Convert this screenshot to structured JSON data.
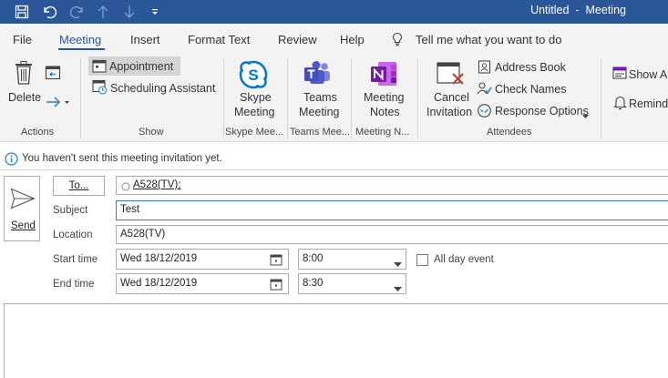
{
  "window": {
    "title": "Untitled  -  Meeting"
  },
  "tabs": [
    "File",
    "Meeting",
    "Insert",
    "Format Text",
    "Review",
    "Help"
  ],
  "tell_me": "Tell me what you want to do",
  "ribbon": {
    "actions": {
      "delete": "Delete",
      "group": "Actions"
    },
    "show": {
      "appointment": "Appointment",
      "scheduling": "Scheduling Assistant",
      "group": "Show"
    },
    "skype": {
      "label1": "Skype",
      "label2": "Meeting",
      "group": "Skype Mee..."
    },
    "teams": {
      "label1": "Teams",
      "label2": "Meeting",
      "group": "Teams Mee..."
    },
    "onenote": {
      "label1": "Meeting",
      "label2": "Notes",
      "group": "Meeting N..."
    },
    "attendees": {
      "cancel1": "Cancel",
      "cancel2": "Invitation",
      "address_book": "Address Book",
      "check_names": "Check Names",
      "response_options": "Response Options",
      "group": "Attendees"
    },
    "options": {
      "show_as": "Show A",
      "reminder": "Remind"
    }
  },
  "info_bar": "You haven't sent this meeting invitation yet.",
  "form": {
    "send": "Send",
    "to_button": "To...",
    "to_value": "A528(TV);",
    "subject_label": "Subject",
    "subject_value": "Test",
    "location_label": "Location",
    "location_value": "A528(TV)",
    "start_label": "Start time",
    "start_date": "Wed 18/12/2019",
    "start_time": "8:00",
    "end_label": "End time",
    "end_date": "Wed 18/12/2019",
    "end_time": "8:30",
    "all_day": "All day event"
  },
  "colors": {
    "titlebar": "#2b579a",
    "accent": "#2b579a",
    "skype": "#0078d4",
    "teams": "#5059c9",
    "onenote": "#7719aa",
    "cancel_x": "#d9302c"
  }
}
